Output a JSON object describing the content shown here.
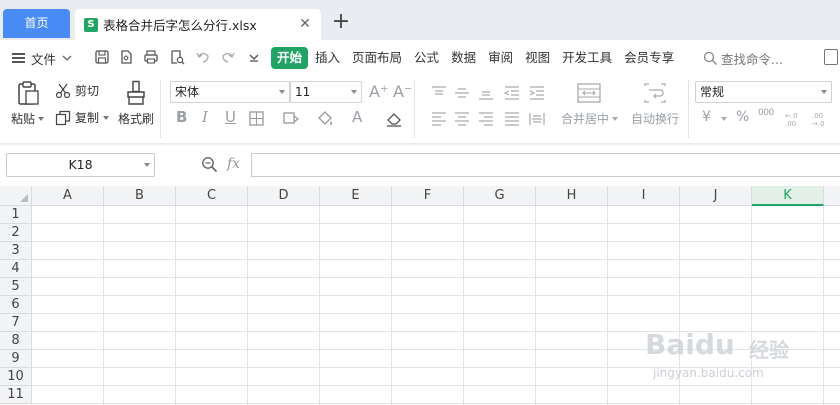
{
  "tabs": {
    "home_label": "首页",
    "file_icon_letter": "S",
    "file_name": "表格合并后字怎么分行.xlsx",
    "close_glyph": "✕",
    "new_tab_glyph": "+"
  },
  "menu": {
    "file_label": "文件",
    "tabs": [
      "开始",
      "插入",
      "页面布局",
      "公式",
      "数据",
      "审阅",
      "视图",
      "开发工具",
      "会员专享"
    ],
    "active_tab": "开始",
    "search_placeholder": "查找命令..."
  },
  "ribbon": {
    "paste_label": "粘贴",
    "cut_label": "剪切",
    "copy_label": "复制",
    "format_painter_label": "格式刷",
    "font_name": "宋体",
    "font_size": "11",
    "bold": "B",
    "italic": "I",
    "underline": "U",
    "font_color_letter": "A",
    "grow_font": "A⁺",
    "shrink_font": "A⁻",
    "merge_label": "合并居中",
    "wrap_label": "自动换行",
    "number_format": "常规",
    "currency_glyph": "¥",
    "percent_glyph": "%",
    "thousands_glyph": "000"
  },
  "formula_bar": {
    "cell_ref": "K18",
    "fx": "fx",
    "formula_value": ""
  },
  "grid": {
    "columns": [
      "A",
      "B",
      "C",
      "D",
      "E",
      "F",
      "G",
      "H",
      "I",
      "J",
      "K"
    ],
    "selected_column": "K",
    "rows": [
      "1",
      "2",
      "3",
      "4",
      "5",
      "6",
      "7",
      "8",
      "9",
      "10",
      "11"
    ]
  },
  "watermark": {
    "brand": "Baidu",
    "brand_cn": "经验",
    "url": "jingyan.baidu.com"
  },
  "colors": {
    "accent_green": "#21a366",
    "home_tab_blue": "#4a8cf5",
    "tabbar_bg": "#e9ecf1"
  }
}
